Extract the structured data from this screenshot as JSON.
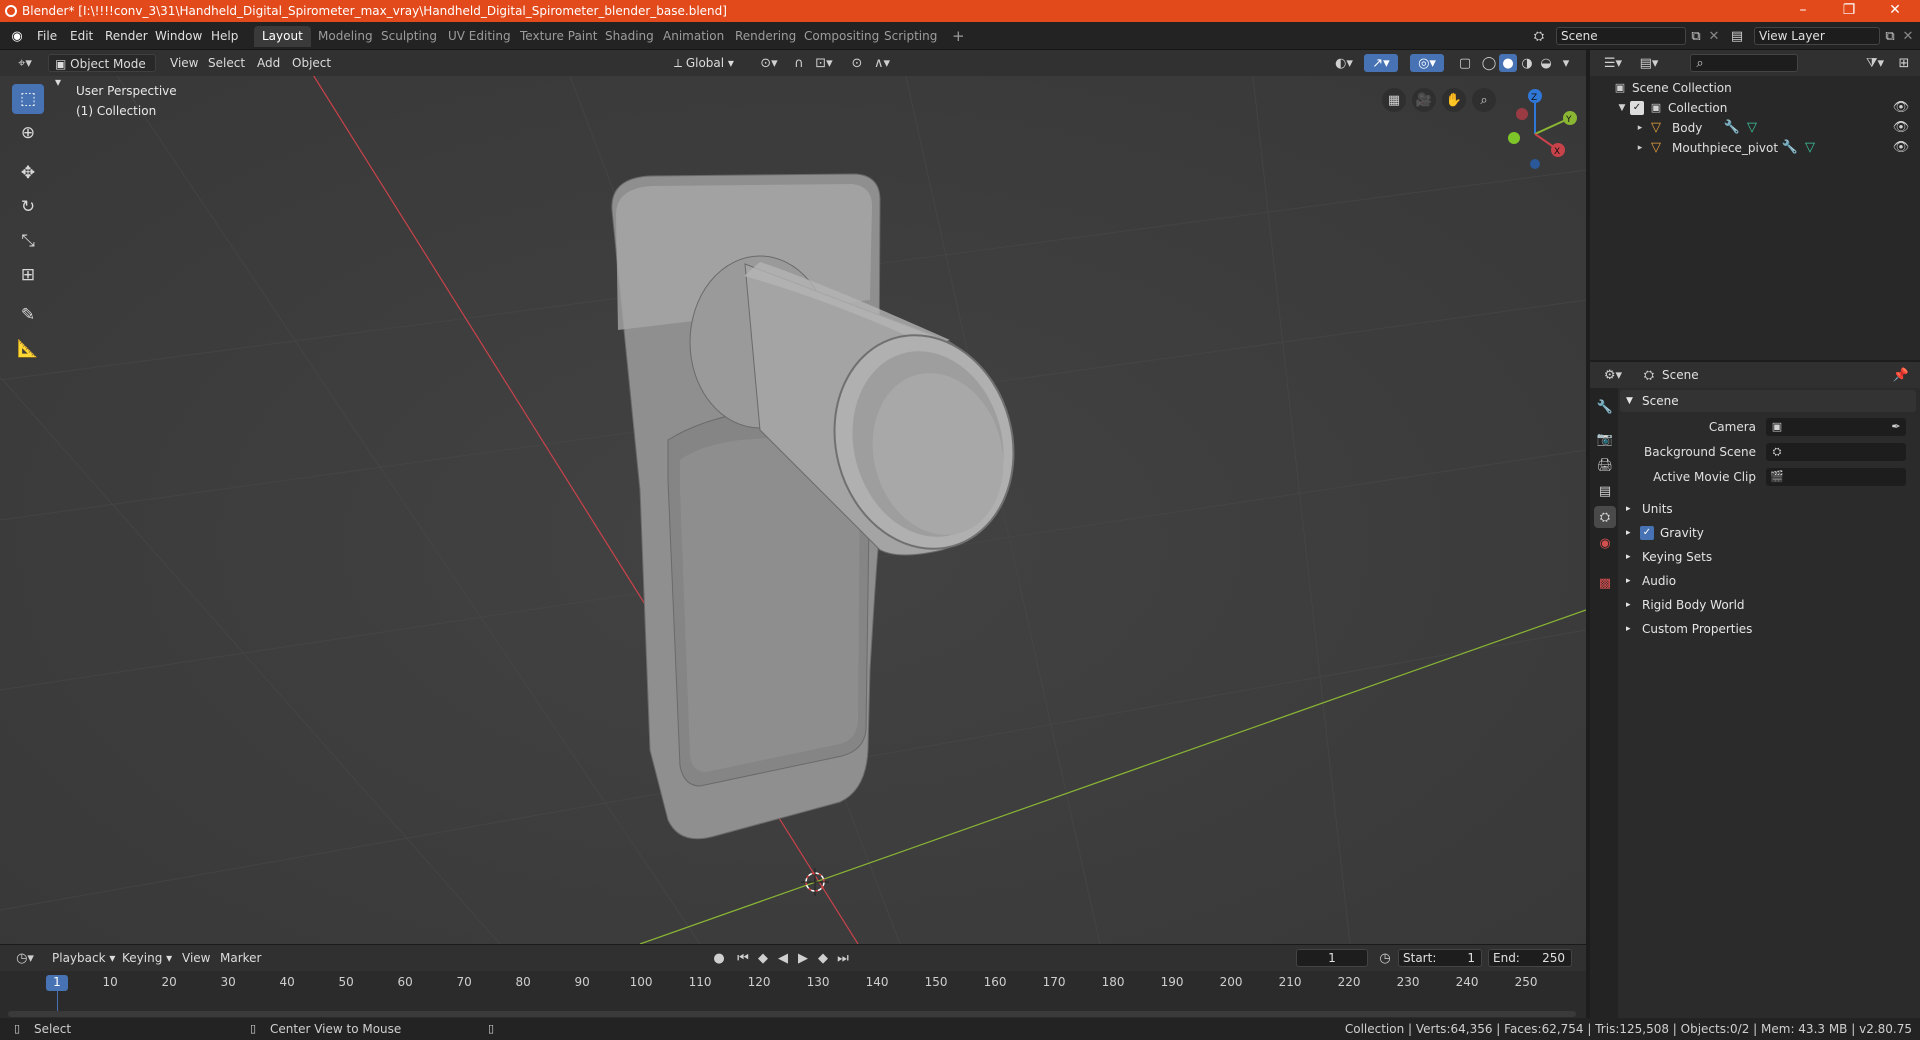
{
  "window": {
    "title": "Blender* [I:\\!!!!conv_3\\31\\Handheld_Digital_Spirometer_max_vray\\Handheld_Digital_Spirometer_blender_base.blend]",
    "minimize": "–",
    "maximize": "❐",
    "close": "✕"
  },
  "menu": {
    "items": [
      "File",
      "Edit",
      "Render",
      "Window",
      "Help"
    ]
  },
  "workspaces": [
    "Layout",
    "Modeling",
    "Sculpting",
    "UV Editing",
    "Texture Paint",
    "Shading",
    "Animation",
    "Rendering",
    "Compositing",
    "Scripting"
  ],
  "workspace_add": "+",
  "scene_selector": {
    "value": "Scene"
  },
  "view_layer_selector": {
    "value": "View Layer"
  },
  "viewport": {
    "mode": "Object Mode",
    "menus": [
      "View",
      "Select",
      "Add",
      "Object"
    ],
    "transform_orientation": "Global",
    "overlay_title": "User Perspective",
    "overlay_collection": "(1) Collection",
    "gizmo": {
      "x": "X",
      "y": "Y",
      "z": "Z"
    }
  },
  "outliner": {
    "search_placeholder": "",
    "root": "Scene Collection",
    "collection": "Collection",
    "objects": [
      "Body",
      "Mouthpiece_pivot"
    ]
  },
  "properties": {
    "header": "Scene",
    "panel": "Scene",
    "fields": [
      {
        "label": "Camera",
        "value": ""
      },
      {
        "label": "Background Scene",
        "value": ""
      },
      {
        "label": "Active Movie Clip",
        "value": ""
      }
    ],
    "sections": [
      "Units",
      "Gravity",
      "Keying Sets",
      "Audio",
      "Rigid Body World",
      "Custom Properties"
    ],
    "gravity_checked": true
  },
  "timeline": {
    "menus": [
      "Playback",
      "Keying",
      "View",
      "Marker"
    ],
    "current_frame": "1",
    "start_label": "Start:",
    "start_value": "1",
    "end_label": "End:",
    "end_value": "250",
    "frame_ticks": [
      "1",
      "10",
      "20",
      "30",
      "40",
      "50",
      "60",
      "70",
      "80",
      "90",
      "100",
      "110",
      "120",
      "130",
      "140",
      "150",
      "160",
      "170",
      "180",
      "190",
      "200",
      "210",
      "220",
      "230",
      "240",
      "250"
    ]
  },
  "statusbar": {
    "left_action": "Select",
    "middle_action": "Center View to Mouse",
    "stats": "Collection | Verts:64,356 | Faces:62,754 | Tris:125,508 | Objects:0/2 | Mem: 43.3 MB | v2.80.75"
  },
  "colors": {
    "titlebar": "#e34a1b",
    "accent": "#4772b3",
    "x_axis": "#c8424a",
    "y_axis": "#8ab634",
    "z_axis": "#2f78d8"
  }
}
